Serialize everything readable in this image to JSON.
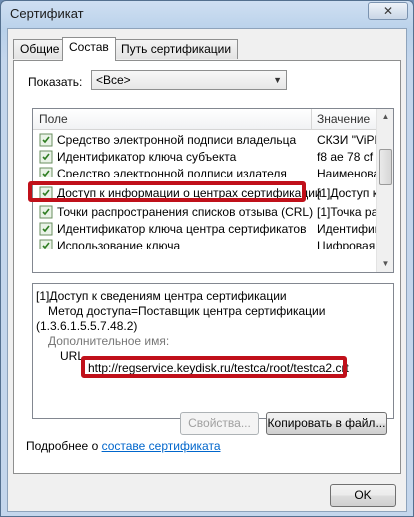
{
  "window": {
    "title": "Сертификат",
    "close_glyph": "✕"
  },
  "tabs": [
    {
      "label": "Общие",
      "active": false
    },
    {
      "label": "Состав",
      "active": true
    },
    {
      "label": "Путь сертификации",
      "active": false
    }
  ],
  "show": {
    "label": "Показать:",
    "selected": "<Все>"
  },
  "fields_list": {
    "col_field": "Поле",
    "col_value": "Значение",
    "rows": [
      {
        "name": "Средство электронной подписи владельца",
        "value": "СКЗИ \"ViPNe"
      },
      {
        "name": "Идентификатор ключа субъекта",
        "value": "f8 ae 78 cf a"
      },
      {
        "name": "Средство электронной подписи издателя",
        "value": "Наименован"
      },
      {
        "name": "Доступ к информации о центрах сертификации",
        "value": "[1]Доступ к"
      },
      {
        "name": "Точки распространения списков отзыва (CRL)",
        "value": "[1]Точка рас"
      },
      {
        "name": "Идентификатор ключа центра сертификатов",
        "value": "Идентифика"
      },
      {
        "name": "Использование ключа",
        "value": "Цифровая п"
      }
    ]
  },
  "detail": {
    "line1": "[1]Доступ к сведениям центра сертификации",
    "line2": "Метод доступа=Поставщик центра сертификации",
    "line3": "(1.3.6.1.5.5.7.48.2)",
    "line4_partial": "Дополнительное имя:",
    "url_label": "URL",
    "url_value": "http://regservice.keydisk.ru/testca/root/testca2.crt"
  },
  "buttons": {
    "properties": "Свойства...",
    "copy_to_file": "Копировать в файл...",
    "ok": "OK"
  },
  "more_info": {
    "prefix": "Подробнее о ",
    "link": "составе сертификата"
  },
  "colors": {
    "highlight": "#c0101a",
    "link": "#0066cc"
  }
}
